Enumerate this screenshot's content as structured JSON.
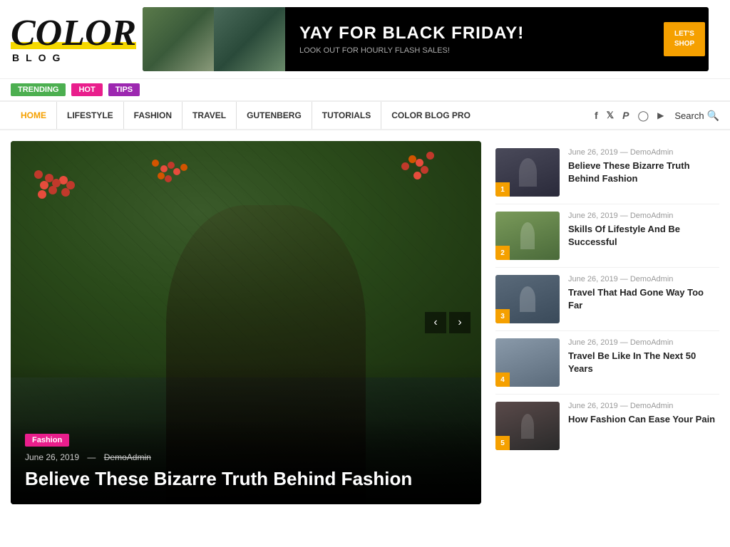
{
  "logo": {
    "color_text": "COLOR",
    "blog_text": "BLOG"
  },
  "banner": {
    "title": "YAY FOR BLACK FRIDAY!",
    "subtitle": "LOOK OUT FOR HOURLY FLASH SALES!",
    "cta_line1": "LET'S",
    "cta_line2": "SHOP"
  },
  "trending_tags": [
    {
      "label": "TRENDING",
      "class": "tag-trending"
    },
    {
      "label": "HOT",
      "class": "tag-hot"
    },
    {
      "label": "TIPS",
      "class": "tag-tips"
    }
  ],
  "nav": {
    "items": [
      {
        "label": "HOME",
        "active": true
      },
      {
        "label": "LIFESTYLE",
        "active": false
      },
      {
        "label": "FASHION",
        "active": false
      },
      {
        "label": "TRAVEL",
        "active": false
      },
      {
        "label": "GUTENBERG",
        "active": false
      },
      {
        "label": "TUTORIALS",
        "active": false
      },
      {
        "label": "COLOR BLOG PRO",
        "active": false
      }
    ],
    "search_label": "Search"
  },
  "featured": {
    "category": "Fashion",
    "date": "June 26, 2019",
    "author": "DemoAdmin",
    "title": "Believe These Bizarre Truth Behind Fashion"
  },
  "sidebar_articles": [
    {
      "num": "1",
      "date": "June 26, 2019",
      "author": "DemoAdmin",
      "title": "Believe These Bizarre Truth Behind Fashion",
      "thumb_class": "thumb-1"
    },
    {
      "num": "2",
      "date": "June 26, 2019",
      "author": "DemoAdmin",
      "title": "Skills Of Lifestyle And Be Successful",
      "thumb_class": "thumb-2"
    },
    {
      "num": "3",
      "date": "June 26, 2019",
      "author": "DemoAdmin",
      "title": "Travel That Had Gone Way Too Far",
      "thumb_class": "thumb-3"
    },
    {
      "num": "4",
      "date": "June 26, 2019",
      "author": "DemoAdmin",
      "title": "Travel Be Like In The Next 50 Years",
      "thumb_class": "thumb-4"
    },
    {
      "num": "5",
      "date": "June 26, 2019",
      "author": "DemoAdmin",
      "title": "How Fashion Can Ease Your Pain",
      "thumb_class": "thumb-5"
    }
  ],
  "social_icons": [
    "f",
    "𝕏",
    "𝒫",
    "📷",
    "▶"
  ],
  "colors": {
    "accent_yellow": "#f5a000",
    "accent_pink": "#e91e8c",
    "accent_green": "#4caf50",
    "accent_purple": "#9c27b0"
  }
}
